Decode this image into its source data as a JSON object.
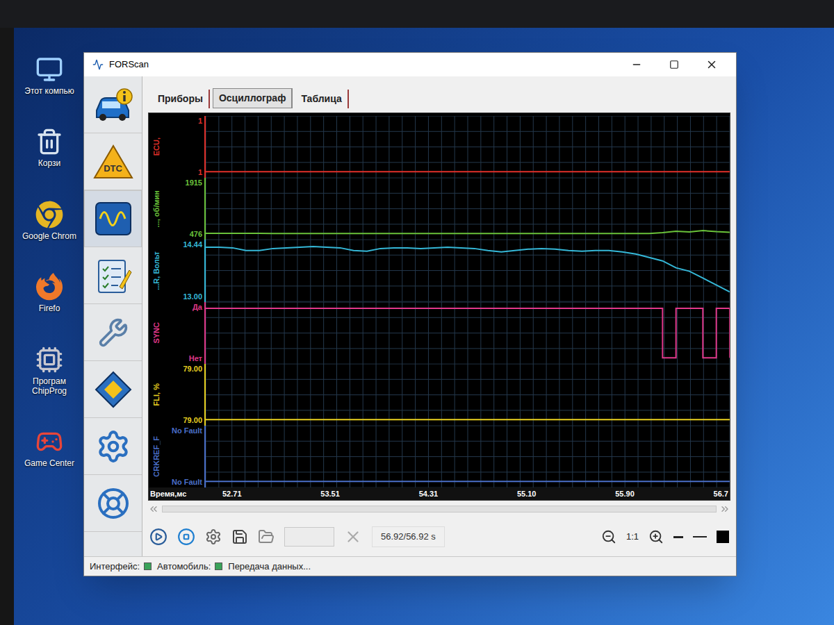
{
  "desktop_icons": [
    {
      "label": "Этот компью",
      "kind": "computer"
    },
    {
      "label": "Корзи",
      "kind": "recycle"
    },
    {
      "label": "Google Chrom",
      "kind": "chrome"
    },
    {
      "label": "Firefo",
      "kind": "firefox"
    },
    {
      "label": "Програм ChipProg",
      "kind": "chipprog"
    },
    {
      "label": "Game Center",
      "kind": "game"
    }
  ],
  "window": {
    "title": "FORScan"
  },
  "sidebar": {
    "items": [
      {
        "kind": "info",
        "selected": false
      },
      {
        "kind": "dtc",
        "label": "DTC",
        "selected": false
      },
      {
        "kind": "oscilloscope",
        "selected": true
      },
      {
        "kind": "checklist",
        "selected": false
      },
      {
        "kind": "service",
        "selected": false
      },
      {
        "kind": "modules",
        "selected": false
      },
      {
        "kind": "settings",
        "selected": false
      },
      {
        "kind": "help",
        "selected": false
      }
    ]
  },
  "tabs": [
    {
      "label": "Приборы",
      "selected": false
    },
    {
      "label": "Осциллограф",
      "selected": true
    },
    {
      "label": "Таблица",
      "selected": false
    }
  ],
  "chart": {
    "time_axis": {
      "label": "Время,мс",
      "ticks": [
        "52.71",
        "53.51",
        "54.31",
        "55.10",
        "55.90",
        "56.7"
      ]
    },
    "channels": [
      {
        "name": "ECU,",
        "top": "1",
        "bottom": "1",
        "axis_max": 1,
        "axis_min": 1,
        "color": "#e0302a",
        "kind": "line",
        "values": [
          1,
          1,
          1,
          1,
          1,
          1,
          1,
          1,
          1,
          1,
          1,
          1,
          1,
          1,
          1,
          1,
          1,
          1,
          1,
          1,
          1,
          1,
          1,
          1,
          1,
          1,
          1,
          1,
          1,
          1,
          1,
          1,
          1,
          1,
          1,
          1,
          1,
          1,
          1,
          1
        ]
      },
      {
        "name": "..., об/мин",
        "top": "1915",
        "bottom": "476",
        "axis_max": 1915,
        "axis_min": 476,
        "color": "#6ac23a",
        "kind": "line",
        "values": [
          480,
          480,
          480,
          479,
          479,
          478,
          478,
          478,
          477,
          477,
          477,
          477,
          476,
          476,
          476,
          476,
          476,
          476,
          476,
          476,
          476,
          476,
          476,
          476,
          476,
          476,
          476,
          476,
          476,
          476,
          476,
          476,
          476,
          476,
          500,
          540,
          520,
          560,
          530,
          510
        ]
      },
      {
        "name": "...R, Вольт",
        "top": "14.44",
        "bottom": "13.00",
        "axis_max": 14.44,
        "axis_min": 13.0,
        "color": "#35b8d8",
        "kind": "line",
        "values": [
          14.4,
          14.4,
          14.38,
          14.3,
          14.3,
          14.36,
          14.38,
          14.4,
          14.42,
          14.4,
          14.38,
          14.3,
          14.28,
          14.36,
          14.38,
          14.38,
          14.36,
          14.38,
          14.4,
          14.38,
          14.36,
          14.3,
          14.26,
          14.3,
          14.34,
          14.36,
          14.34,
          14.3,
          14.28,
          14.3,
          14.3,
          14.26,
          14.2,
          14.1,
          14.0,
          13.8,
          13.7,
          13.5,
          13.3,
          13.1
        ]
      },
      {
        "name": "SYNC",
        "top": "Да",
        "bottom": "Нет",
        "axis_max": 1,
        "axis_min": 0,
        "color": "#e0388a",
        "kind": "step",
        "values": [
          1,
          1,
          1,
          1,
          1,
          1,
          1,
          1,
          1,
          1,
          1,
          1,
          1,
          1,
          1,
          1,
          1,
          1,
          1,
          1,
          1,
          1,
          1,
          1,
          1,
          1,
          1,
          1,
          1,
          1,
          1,
          1,
          1,
          1,
          0,
          1,
          1,
          0,
          1,
          0
        ]
      },
      {
        "name": "FLI, %",
        "top": "79.00",
        "bottom": "79.00",
        "axis_max": 79,
        "axis_min": 79,
        "color": "#e8d020",
        "kind": "line",
        "values": [
          79,
          79,
          79,
          79,
          79,
          79,
          79,
          79,
          79,
          79,
          79,
          79,
          79,
          79,
          79,
          79,
          79,
          79,
          79,
          79,
          79,
          79,
          79,
          79,
          79,
          79,
          79,
          79,
          79,
          79,
          79,
          79,
          79,
          79,
          79,
          79,
          79,
          79,
          79,
          79
        ]
      },
      {
        "name": "CRKREF_F",
        "top": "No Fault",
        "bottom": "No Fault",
        "axis_max": 0,
        "axis_min": 0,
        "color": "#4a6fc8",
        "kind": "line",
        "values": [
          0,
          0,
          0,
          0,
          0,
          0,
          0,
          0,
          0,
          0,
          0,
          0,
          0,
          0,
          0,
          0,
          0,
          0,
          0,
          0,
          0,
          0,
          0,
          0,
          0,
          0,
          0,
          0,
          0,
          0,
          0,
          0,
          0,
          0,
          0,
          0,
          0,
          0,
          0,
          0
        ]
      }
    ]
  },
  "toolbar": {
    "time": "56.92/56.92 s",
    "zoom": "1:1"
  },
  "status_bar": {
    "items": [
      {
        "label": "Интерфейс:",
        "ok": true
      },
      {
        "label": "Автомобиль:",
        "ok": true
      }
    ],
    "text": "Передача данных..."
  }
}
